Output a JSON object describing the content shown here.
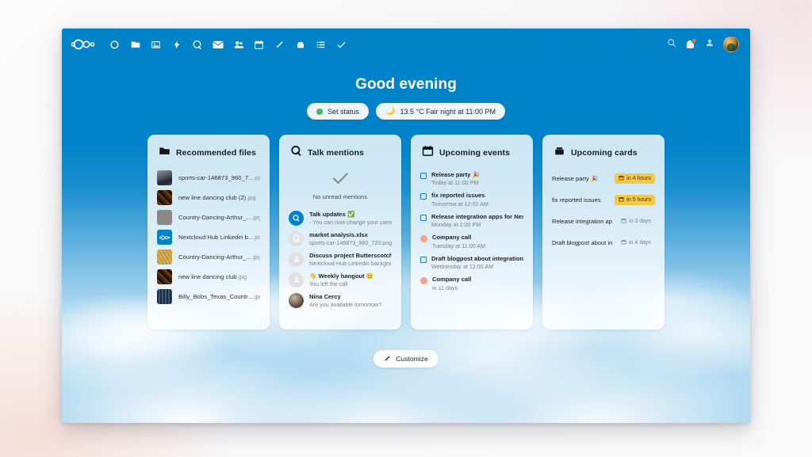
{
  "header": {
    "logo_name": "nextcloud-logo",
    "nav_items": [
      {
        "name": "dashboard-icon",
        "label": "Dashboard"
      },
      {
        "name": "files-icon",
        "label": "Files"
      },
      {
        "name": "photos-icon",
        "label": "Photos"
      },
      {
        "name": "activity-icon",
        "label": "Activity"
      },
      {
        "name": "talk-icon",
        "label": "Talk"
      },
      {
        "name": "mail-icon",
        "label": "Mail"
      },
      {
        "name": "contacts-icon",
        "label": "Contacts"
      },
      {
        "name": "calendar-icon",
        "label": "Calendar"
      },
      {
        "name": "notes-icon",
        "label": "Notes"
      },
      {
        "name": "deck-icon",
        "label": "Deck"
      },
      {
        "name": "lists-icon",
        "label": "Lists"
      },
      {
        "name": "tasks-icon",
        "label": "Tasks"
      }
    ],
    "search_label": "Search",
    "notifications_label": "Notifications",
    "contacts_menu_label": "Contacts menu",
    "avatar_label": "User avatar"
  },
  "greeting": {
    "text": "Good evening",
    "status_button": "Set status",
    "weather_button": "13.5 °C Fair night at 11:00 PM"
  },
  "widgets": {
    "recommended_files": {
      "title": "Recommended files",
      "icon": "folder-icon",
      "items": [
        {
          "name": "sports-car-146873_960_7...",
          "ext": ".png",
          "thumb": "car"
        },
        {
          "name": "new line dancing club (2)",
          "ext": ".jpg",
          "thumb": "dance-dark"
        },
        {
          "name": "Country-Dancing-Arthur_...",
          "ext": ".jpg",
          "thumb": "dance-gold"
        },
        {
          "name": "Nextcloud Hub Linkedin b...",
          "ext": ".png",
          "thumb": "nextcloud"
        },
        {
          "name": "Country-Dancing-Arthur_...",
          "ext": ".jpg",
          "thumb": "dance-gold"
        },
        {
          "name": "new line dancing club",
          "ext": ".jpg",
          "thumb": "dance-dark"
        },
        {
          "name": "Billy_Bobs_Texas_Countr...",
          "ext": ".jpg",
          "thumb": "billy"
        }
      ]
    },
    "talk_mentions": {
      "title": "Talk mentions",
      "icon": "talk-icon",
      "empty_state": "No unread mentions",
      "items": [
        {
          "title": "Talk updates ✅",
          "subtitle": "- You can now change your camer...",
          "avatar": "talk"
        },
        {
          "title": "market analysis.xlsx",
          "subtitle": "sports-car-146873_960_720.png",
          "avatar": "file"
        },
        {
          "title": "Discuss project Butterscotch",
          "subtitle": "Nextcloud Hub Linkedin backgrou...",
          "avatar": "user"
        },
        {
          "title": "👋 Weekly hangout 😊",
          "subtitle": "You left the call",
          "avatar": "user"
        },
        {
          "title": "Nina Cercy",
          "subtitle": "Are you available tomorrow?",
          "avatar": "photo"
        }
      ]
    },
    "upcoming_events": {
      "title": "Upcoming events",
      "icon": "calendar-icon",
      "items": [
        {
          "title": "Release party 🎉",
          "time": "Today at 11:00 PM",
          "marker": "checkbox"
        },
        {
          "title": "fix reported issues",
          "time": "Tomorrow at 12:00 AM",
          "marker": "checkbox"
        },
        {
          "title": "Release integration apps for Nextclou...",
          "time": "Monday at 2:00 PM",
          "marker": "checkbox"
        },
        {
          "title": "Company call",
          "time": "Tuesday at 11:00 AM",
          "marker": "dot"
        },
        {
          "title": "Draft blogpost about integration",
          "time": "Wednesday at 12:00 AM",
          "marker": "checkbox"
        },
        {
          "title": "Company call",
          "time": "in 11 days",
          "marker": "dot"
        }
      ]
    },
    "upcoming_cards": {
      "title": "Upcoming cards",
      "icon": "deck-icon",
      "items": [
        {
          "title": "Release party 🎉",
          "due": "in 4 hours",
          "style": "warn"
        },
        {
          "title": "fix reported issues",
          "due": "in 5 hours",
          "style": "warn"
        },
        {
          "title": "Release integration apps for...",
          "due": "in 3 days",
          "style": "plain"
        },
        {
          "title": "Draft blogpost about integra...",
          "due": "in 4 days",
          "style": "plain"
        }
      ]
    }
  },
  "footer": {
    "customize_label": "Customize",
    "customize_icon": "pencil-icon"
  },
  "colors": {
    "brand": "#0082c9",
    "badge_warn": "#f5c842",
    "status_online": "#46ba61",
    "event_dot": "#f4a08a"
  }
}
